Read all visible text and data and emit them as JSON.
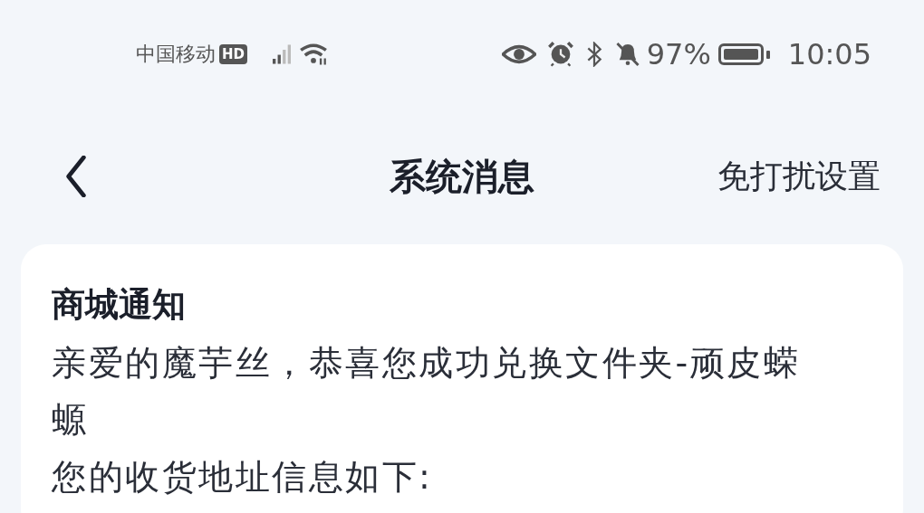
{
  "status_bar": {
    "carrier": "中国移动",
    "hd_badge": "HD",
    "battery_text": "97%",
    "time": "10:05"
  },
  "header": {
    "title": "系统消息",
    "action": "免打扰设置"
  },
  "message": {
    "title": "商城通知",
    "lines": [
      "亲爱的魔芋丝，恭喜您成功兑换文件夹-顽皮蝾螈",
      "您的收货地址信息如下:"
    ]
  }
}
